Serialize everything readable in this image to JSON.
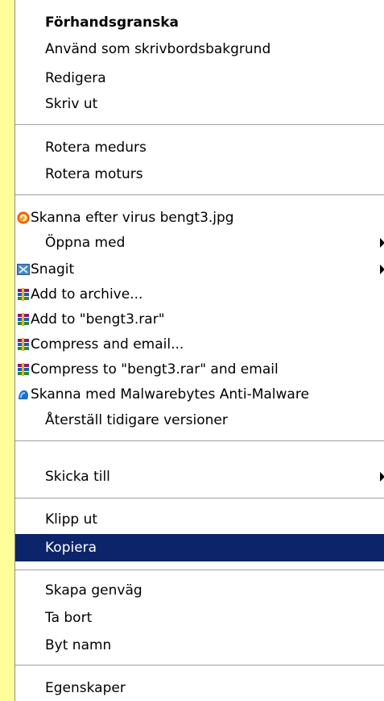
{
  "menu": {
    "items": [
      {
        "label": "Förhandsgranska"
      },
      {
        "label": "Använd som skrivbordsbakgrund"
      },
      {
        "label": "Redigera"
      },
      {
        "label": "Skriv ut"
      },
      {
        "label": "Rotera medurs"
      },
      {
        "label": "Rotera moturs"
      },
      {
        "label": "Skanna efter virus bengt3.jpg",
        "icon": "antivirus-icon"
      },
      {
        "label": "Öppna med",
        "submenu": true
      },
      {
        "label": "Snagit",
        "icon": "snagit-icon",
        "submenu": true
      },
      {
        "label": "Add to archive...",
        "icon": "winrar-icon"
      },
      {
        "label": "Add to \"bengt3.rar\"",
        "icon": "winrar-icon"
      },
      {
        "label": "Compress and email...",
        "icon": "winrar-icon"
      },
      {
        "label": "Compress to \"bengt3.rar\" and email",
        "icon": "winrar-icon"
      },
      {
        "label": "Skanna med Malwarebytes Anti-Malware",
        "icon": "malwarebytes-icon"
      },
      {
        "label": "Återställ tidigare versioner"
      },
      {
        "label": "Skicka till",
        "submenu": true
      },
      {
        "label": "Klipp ut"
      },
      {
        "label": "Kopiera",
        "selected": true
      },
      {
        "label": "Skapa genväg"
      },
      {
        "label": "Ta bort"
      },
      {
        "label": "Byt namn"
      },
      {
        "label": "Egenskaper"
      }
    ]
  },
  "colors": {
    "background": "#ffff99",
    "selection": "#0c246a"
  }
}
